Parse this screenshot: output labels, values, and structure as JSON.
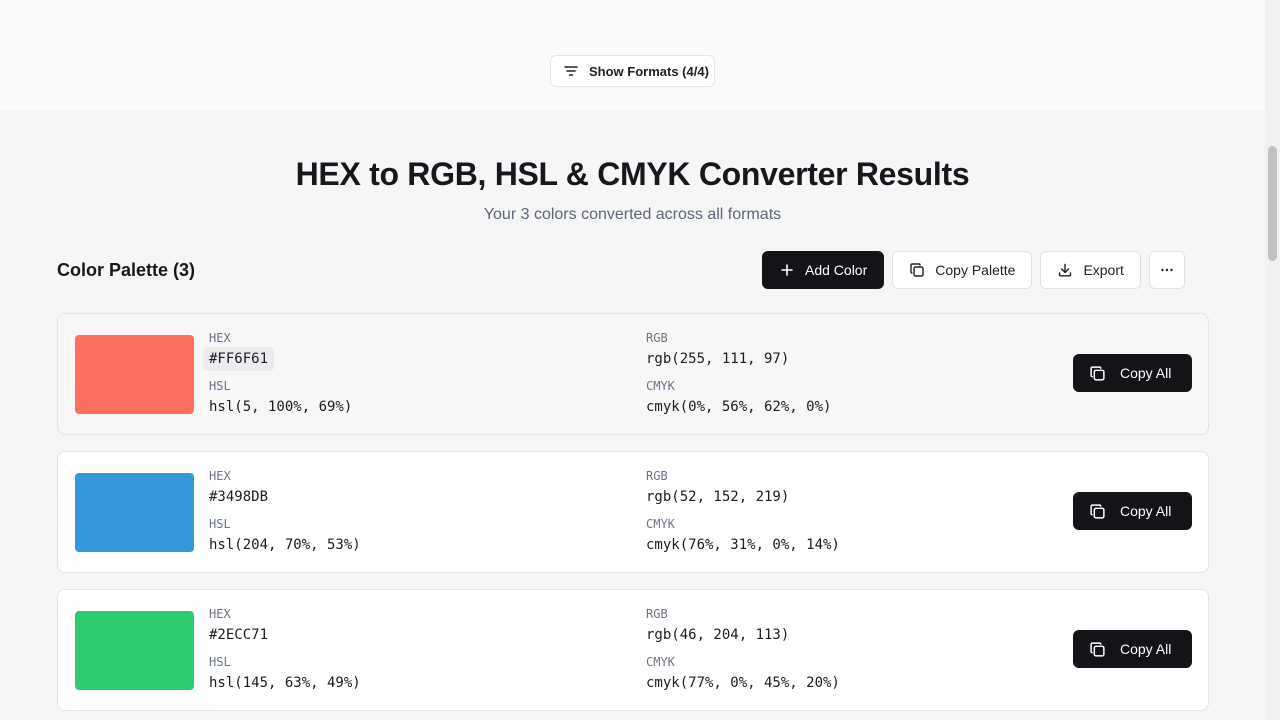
{
  "formats_button": {
    "label": "Show Formats (4/4)",
    "icon": "filter-lines-icon"
  },
  "header": {
    "title": "HEX to RGB, HSL & CMYK Converter Results",
    "subtitle": "Your 3 colors converted across all formats"
  },
  "palette": {
    "title": "Color Palette (3)",
    "actions": {
      "add_label": "Add Color",
      "copy_label": "Copy Palette",
      "export_label": "Export",
      "more_icon": "ellipsis-icon"
    }
  },
  "format_labels": {
    "hex": "HEX",
    "rgb": "RGB",
    "hsl": "HSL",
    "cmyk": "CMYK"
  },
  "colors": [
    {
      "swatch": "#FF6F61",
      "hex": "#FF6F61",
      "rgb": "rgb(255, 111, 97)",
      "hsl": "hsl(5, 100%, 69%)",
      "cmyk": "cmyk(0%, 56%, 62%, 0%)",
      "copy_label": "Copy All"
    },
    {
      "swatch": "#3498DB",
      "hex": "#3498DB",
      "rgb": "rgb(52, 152, 219)",
      "hsl": "hsl(204, 70%, 53%)",
      "cmyk": "cmyk(76%, 31%, 0%, 14%)",
      "copy_label": "Copy All"
    },
    {
      "swatch": "#2ECC71",
      "hex": "#2ECC71",
      "rgb": "rgb(46, 204, 113)",
      "hsl": "hsl(145, 63%, 49%)",
      "cmyk": "cmyk(77%, 0%, 45%, 20%)",
      "copy_label": "Copy All"
    }
  ],
  "theme": {
    "primary_button": "#131417",
    "border": "#E3E4E8",
    "muted_text": "#5D6777"
  }
}
